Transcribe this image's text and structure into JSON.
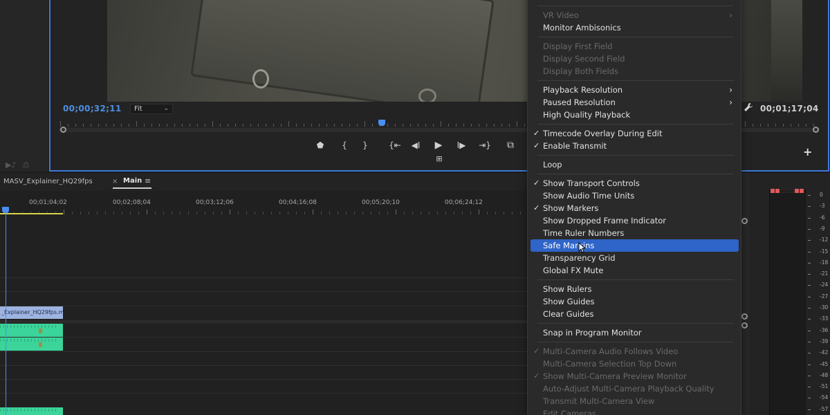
{
  "program_monitor": {
    "timecode_current": "00;00;32;11",
    "zoom_select": "Fit",
    "timecode_duration": "00;01;17;04",
    "playhead_position_fraction": 0.42
  },
  "transport": {
    "buttons": [
      {
        "name": "add-marker",
        "glyph": "⬟"
      },
      {
        "name": "mark-in",
        "glyph": "{"
      },
      {
        "name": "mark-out",
        "glyph": "}"
      },
      {
        "name": "go-to-in",
        "glyph": "{⇤"
      },
      {
        "name": "step-back",
        "glyph": "◀I"
      },
      {
        "name": "play",
        "glyph": "▶"
      },
      {
        "name": "step-forward",
        "glyph": "I▶"
      },
      {
        "name": "go-to-out",
        "glyph": "⇥}"
      },
      {
        "name": "export-frame",
        "glyph": "⧉"
      }
    ],
    "toggle_glyph": "⊞",
    "add_button": "+",
    "wrench_glyph": "🔧"
  },
  "left_panel": {
    "icons": [
      "▶♪",
      "⎙"
    ]
  },
  "timeline": {
    "tabs": [
      {
        "label": "MASV_Explainer_HQ29fps"
      },
      {
        "label": "Main",
        "active": true
      }
    ],
    "close_glyph": "×",
    "menu_glyph": "≡",
    "ruler_labels": [
      "00;01;04;02",
      "00;02;08;04",
      "00;03;12;06",
      "00;04;16;08",
      "00;05;20;10",
      "00;06;24;12"
    ],
    "video_clip_label": "_Explainer_HQ29fps.m"
  },
  "context_menu": {
    "items": [
      {
        "label": "VR Video",
        "disabled": true,
        "submenu": true
      },
      {
        "label": "Monitor Ambisonics"
      },
      {
        "sep": true
      },
      {
        "label": "Display First Field",
        "disabled": true
      },
      {
        "label": "Display Second Field",
        "disabled": true
      },
      {
        "label": "Display Both Fields",
        "disabled": true
      },
      {
        "sep": true
      },
      {
        "label": "Playback Resolution",
        "submenu": true
      },
      {
        "label": "Paused Resolution",
        "submenu": true
      },
      {
        "label": "High Quality Playback"
      },
      {
        "sep": true
      },
      {
        "label": "Timecode Overlay During Edit",
        "checked": true
      },
      {
        "label": "Enable Transmit",
        "checked": true
      },
      {
        "sep": true
      },
      {
        "label": "Loop"
      },
      {
        "sep": true
      },
      {
        "label": "Show Transport Controls",
        "checked": true
      },
      {
        "label": "Show Audio Time Units"
      },
      {
        "label": "Show Markers",
        "checked": true
      },
      {
        "label": "Show Dropped Frame Indicator"
      },
      {
        "label": "Time Ruler Numbers"
      },
      {
        "label": "Safe Margins",
        "highlighted": true
      },
      {
        "label": "Transparency Grid"
      },
      {
        "label": "Global FX Mute"
      },
      {
        "sep": true
      },
      {
        "label": "Show Rulers"
      },
      {
        "label": "Show Guides"
      },
      {
        "label": "Clear Guides"
      },
      {
        "sep": true
      },
      {
        "label": "Snap in Program Monitor"
      },
      {
        "sep": true
      },
      {
        "label": "Multi-Camera Audio Follows Video",
        "disabled": true,
        "checked": true
      },
      {
        "label": "Multi-Camera Selection Top Down",
        "disabled": true
      },
      {
        "label": "Show Multi-Camera Preview Monitor",
        "disabled": true,
        "checked": true
      },
      {
        "label": "Auto-Adjust Multi-Camera Playback Quality",
        "disabled": true
      },
      {
        "label": "Transmit Multi-Camera View",
        "disabled": true
      },
      {
        "label": "Edit Cameras...",
        "disabled": true
      }
    ],
    "check_glyph": "✓",
    "submenu_glyph": "›"
  },
  "audio_meter": {
    "db_scale": [
      "0",
      "-3",
      "-6",
      "-9",
      "-12",
      "-15",
      "-18",
      "-21",
      "-24",
      "-27",
      "-30",
      "-33",
      "-36",
      "-39",
      "-42",
      "-45",
      "-48",
      "-51",
      "-54",
      "-57"
    ],
    "peak_color": "#e0595a"
  },
  "colors": {
    "accent": "#4a8ff0",
    "highlight": "#2f64c8",
    "audio_clip": "#3bd49a",
    "video_clip": "#9db3e0",
    "work_area": "#d8d44a"
  }
}
